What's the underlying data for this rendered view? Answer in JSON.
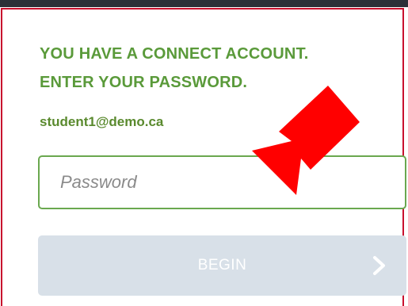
{
  "login": {
    "heading_line1": "YOU HAVE A CONNECT ACCOUNT.",
    "heading_line2": "ENTER YOUR PASSWORD.",
    "email": "student1@demo.ca",
    "password_placeholder": "Password",
    "password_value": "",
    "begin_label": "BEGIN"
  },
  "icons": {
    "begin_chevron": "chevron-right-icon",
    "annotation": "red-arrow-icon"
  },
  "colors": {
    "heading": "#5a9a3a",
    "input_border": "#6aa84f",
    "button_bg": "#d8e0e8",
    "panel_border": "#c8102e",
    "arrow": "#ff0000"
  }
}
